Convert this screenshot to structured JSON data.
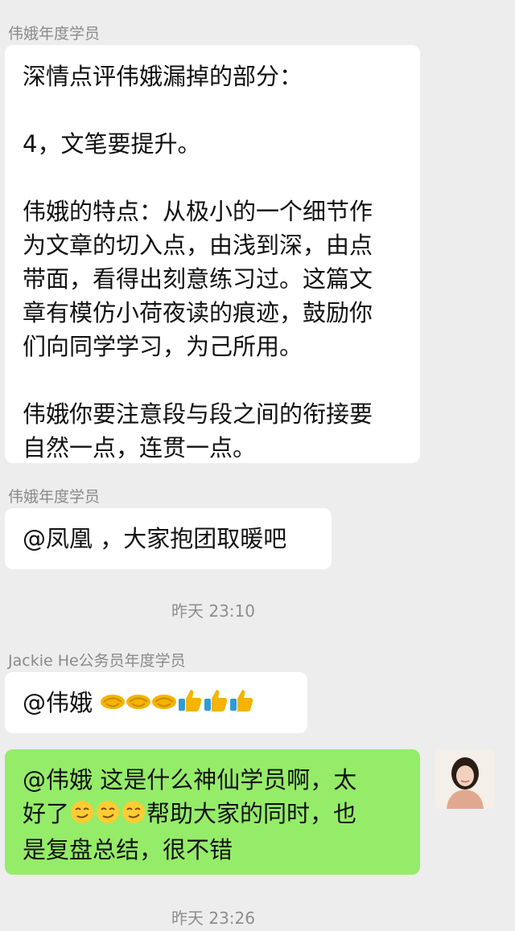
{
  "msg1": {
    "sender": "伟娥年度学员",
    "lines": [
      "深情点评伟娥漏掉的部分：",
      "4，文笔要提升。",
      "伟娥的特点：从极小的一个细节作",
      "为文章的切入点，由浅到深，由点",
      "带面，看得出刻意练习过。这篇文",
      "章有模仿小荷夜读的痕迹，鼓励你",
      "们向同学学习，为己所用。",
      "伟娥你要注意段与段之间的衔接要",
      "自然一点，连贯一点。"
    ]
  },
  "msg2": {
    "sender": "伟娥年度学员",
    "text": "@凤凰 ，大家抱团取暖吧"
  },
  "time1": "昨天 23:10",
  "msg3": {
    "sender": "Jackie He公务员年度学员",
    "text": "@伟娥 "
  },
  "msg4": {
    "line1": "@伟娥  这是什么神仙学员啊，太",
    "line2_prefix": "好了",
    "line2_suffix": "帮助大家的同时，也",
    "line3": "是复盘总结，很不错"
  },
  "time2": "昨天 23:26",
  "icons": {
    "handshake": "handshake-emoji",
    "thumbs_up": "thumbs-up-emoji",
    "smirk": "smirk-emoji",
    "avatar": "user-avatar-photo"
  },
  "colors": {
    "background": "#ededed",
    "incoming_bubble": "#ffffff",
    "outgoing_bubble": "#95ec69"
  }
}
